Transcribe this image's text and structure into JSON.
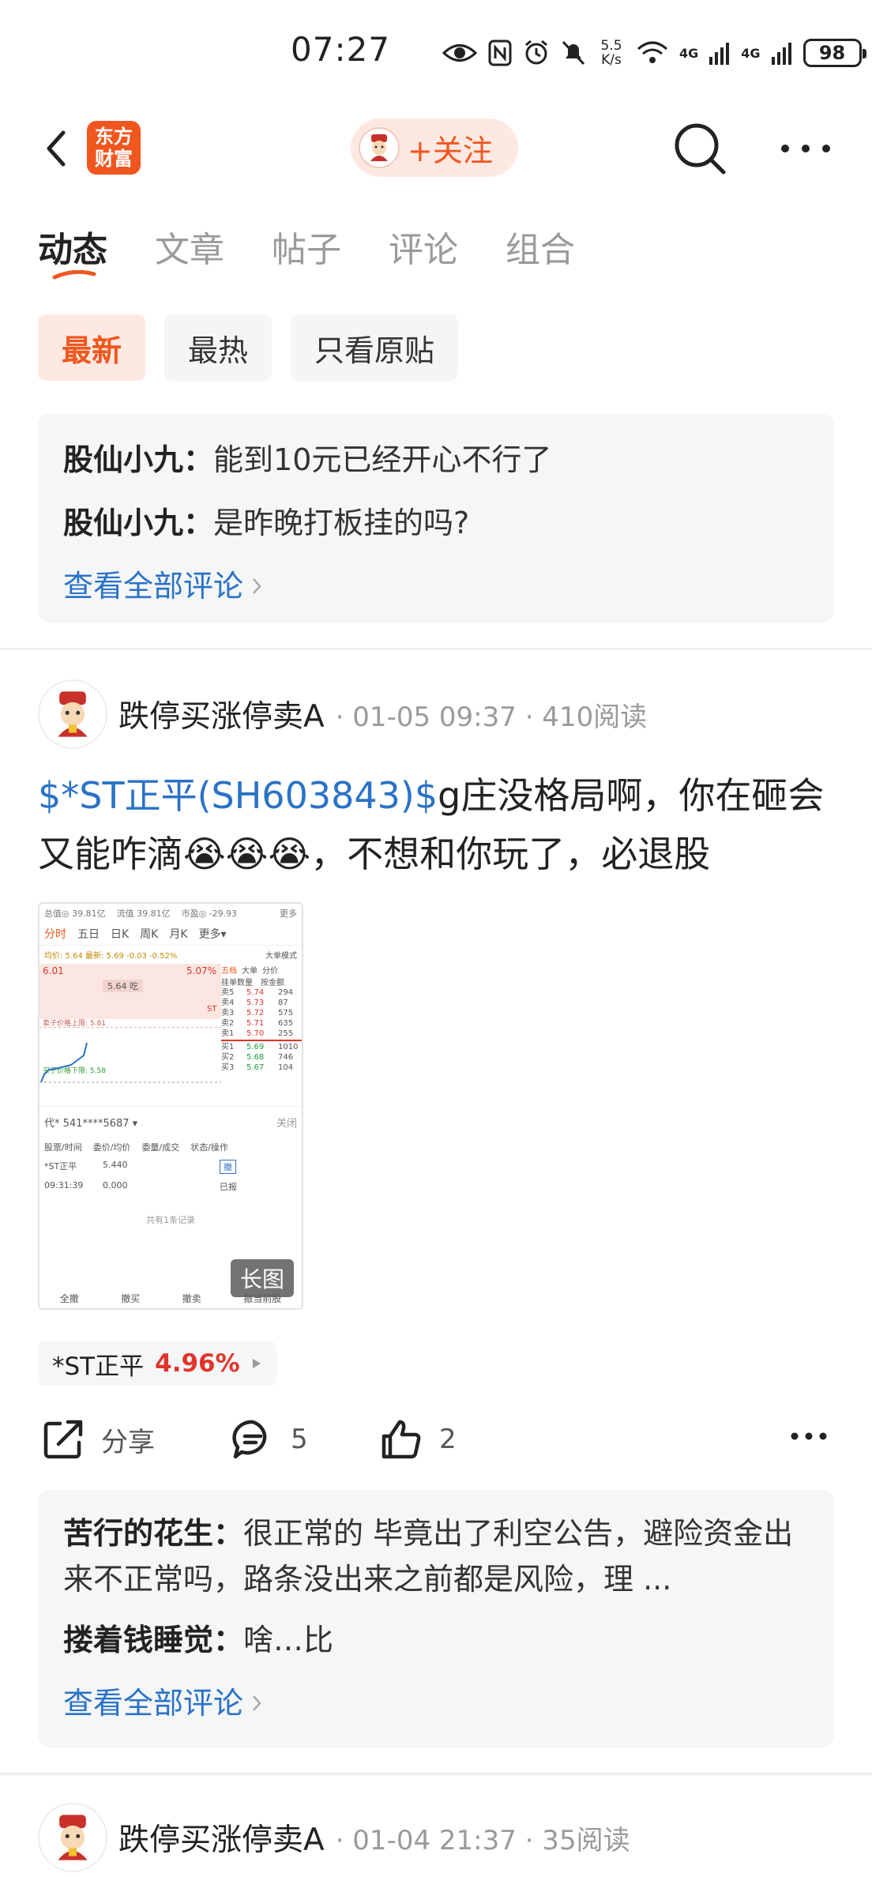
{
  "status_bar": {
    "time": "07:27",
    "net_speed": "5.5\nK/s",
    "net_speed_top": "5.5",
    "net_speed_bottom": "K/s",
    "sig1": "4G",
    "sig2": "4G",
    "battery": "98"
  },
  "nav": {
    "app_logo_line1": "东方",
    "app_logo_line2": "财富",
    "follow_label": "+关注"
  },
  "tabs": [
    {
      "label": "动态"
    },
    {
      "label": "文章"
    },
    {
      "label": "帖子"
    },
    {
      "label": "评论"
    },
    {
      "label": "组合"
    }
  ],
  "filters": [
    {
      "label": "最新"
    },
    {
      "label": "最热"
    },
    {
      "label": "只看原贴"
    }
  ],
  "top_comments": {
    "items": [
      {
        "user": "股仙小九：",
        "text": "能到10元已经开心不行了"
      },
      {
        "user": "股仙小九：",
        "text": "是昨晚打板挂的吗?"
      }
    ],
    "see_all": "查看全部评论"
  },
  "post1": {
    "author": "跌停买涨停卖A",
    "meta": "· 01-05 09:37 · 410阅读",
    "tag": "$*ST正平(SH603843)$",
    "text": "g庄没格局啊，你在砸会又能咋滴😭😭😭，不想和你玩了，必退股",
    "image_badge": "长图",
    "thumb": {
      "row1": [
        "总值◎ 39.81亿",
        "流值 39.81亿",
        "市盈◎ -29.93",
        "更多"
      ],
      "tabs": [
        "分时",
        "五日",
        "日K",
        "周K",
        "月K",
        "更多▾"
      ],
      "avg": "均价: 5.64  最新: 5.69  -0.03  -0.52%",
      "mode": "大单模式",
      "order_tabs": [
        "五档",
        "大单",
        "分价"
      ],
      "col_heads": [
        "挂单数量",
        "按金额"
      ],
      "asks": [
        {
          "k": "卖5",
          "p": "5.74",
          "v": "294"
        },
        {
          "k": "卖4",
          "p": "5.73",
          "v": "87"
        },
        {
          "k": "卖3",
          "p": "5.72",
          "v": "575"
        },
        {
          "k": "卖2",
          "p": "5.71",
          "v": "635"
        },
        {
          "k": "卖1",
          "p": "5.70",
          "v": "255"
        }
      ],
      "bids": [
        {
          "k": "买1",
          "p": "5.69",
          "v": "1010"
        },
        {
          "k": "买2",
          "p": "5.68",
          "v": "746"
        },
        {
          "k": "买3",
          "p": "5.67",
          "v": "104"
        }
      ],
      "left_top": "6.01",
      "price_label": "5.64 吃",
      "pct_label": "5.07%",
      "st_label": "ST",
      "upper": "卖子价格上限: 5.81",
      "lower": "买子价格下限: 5.58",
      "account": "代* 541****5687 ▾",
      "close": "关闭",
      "th": [
        "股票/时间",
        "委价/均价",
        "委量/成交",
        "状态/操作"
      ],
      "rec_name": "*ST正平",
      "rec_price": "5.440",
      "rec_time": "09:31:39",
      "rec_avg": "0.000",
      "rec_status": "已报",
      "rec_action": "撤",
      "total": "共有1条记录",
      "bottom": [
        "全撤",
        "撤买",
        "撤卖",
        "撤当前股"
      ]
    },
    "stock_name": "*ST正平",
    "stock_pct": "4.96%",
    "share": "分享",
    "comment_count": "5",
    "like_count": "2",
    "comments": [
      {
        "user": "苦行的花生：",
        "text": "很正常的 毕竟出了利空公告，避险资金出来不正常吗，路条没出来之前都是风险，理 ..."
      },
      {
        "user": "搂着钱睡觉：",
        "text": "啥…比"
      }
    ],
    "see_all": "查看全部评论"
  },
  "post2": {
    "author": "跌停买涨停卖A",
    "meta": "· 01-04 21:37 · 35阅读"
  },
  "colors": {
    "accent": "#f0571f",
    "link": "#2a72c6",
    "up": "#e0352b",
    "down": "#1f9d3a"
  }
}
